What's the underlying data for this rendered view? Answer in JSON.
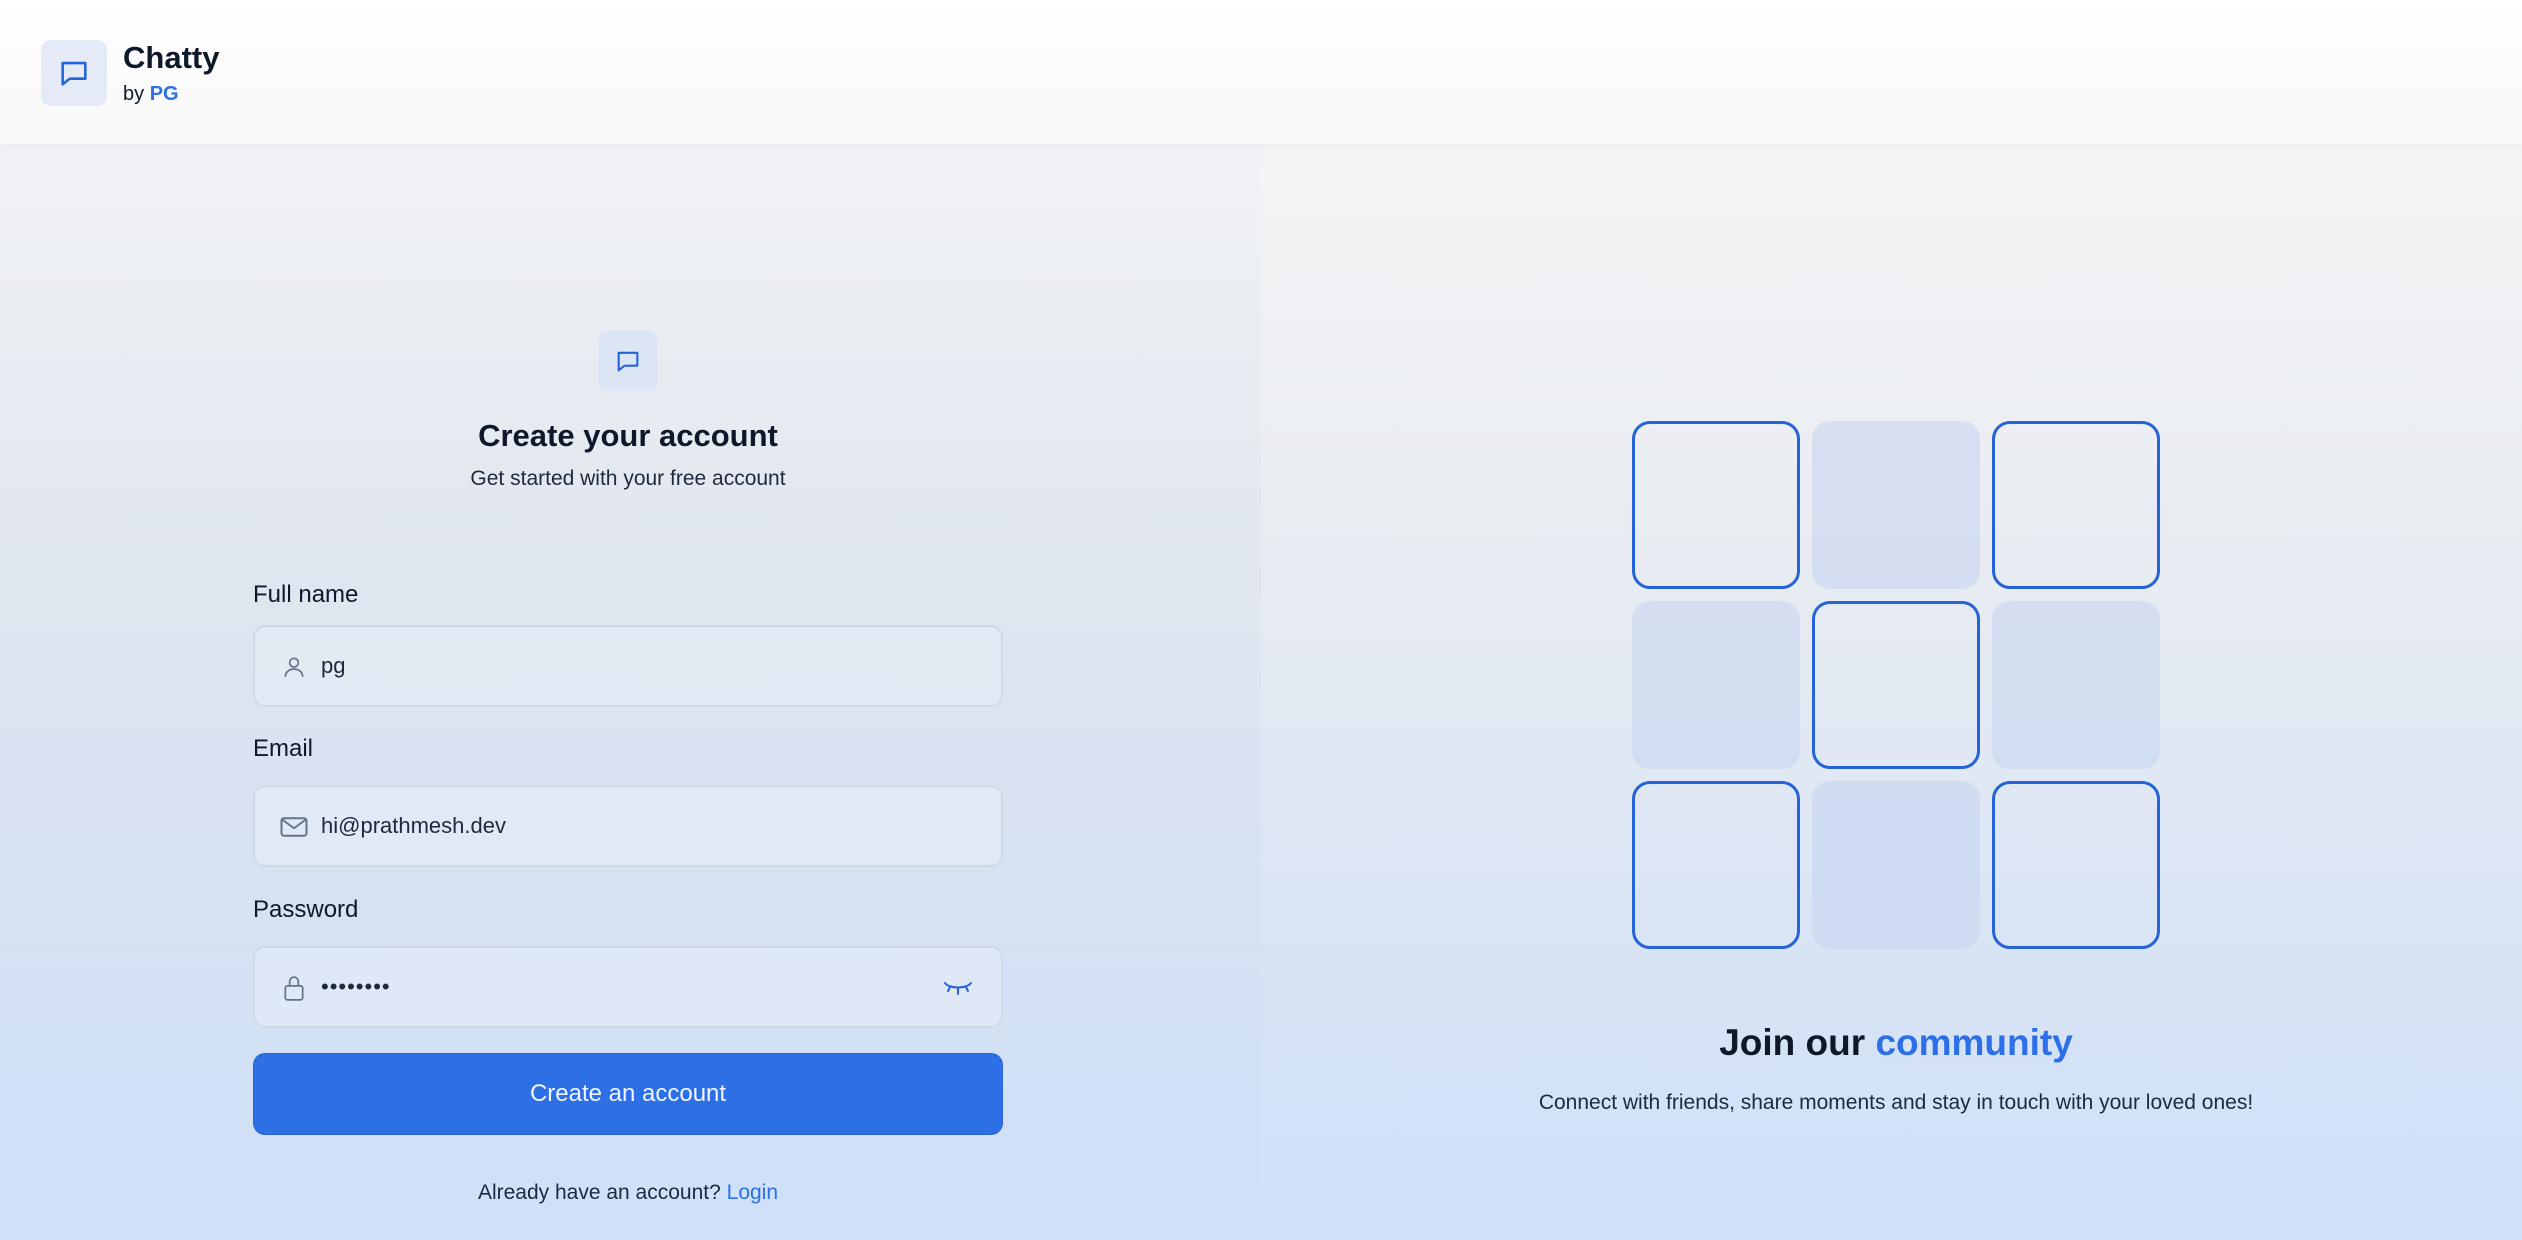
{
  "brand": {
    "name": "Chatty",
    "by_prefix": "by",
    "by_owner": "PG",
    "logo_icon": "chat-bubble-icon"
  },
  "form": {
    "logo_icon": "chat-bubble-icon",
    "title": "Create your account",
    "subtitle": "Get started with your free account",
    "fields": [
      {
        "label": "Full name",
        "value": "pg",
        "icon": "user-icon",
        "type": "text"
      },
      {
        "label": "Email",
        "value": "hi@prathmesh.dev",
        "icon": "mail-icon",
        "type": "email"
      },
      {
        "label": "Password",
        "value": "••••••••",
        "icon": "lock-icon",
        "type": "password",
        "toggle_icon": "eye-closed-icon"
      }
    ],
    "submit_label": "Create an account",
    "login_prompt": "Already have an account?",
    "login_link": "Login"
  },
  "community": {
    "title_prefix": "Join our",
    "title_accent": "community",
    "description": "Connect with friends, share moments and stay in touch with your loved ones!",
    "tiles": [
      "outlined",
      "filled",
      "outlined",
      "filled",
      "outlined",
      "filled",
      "outlined",
      "filled",
      "outlined"
    ]
  },
  "colors": {
    "accent": "#2c6fe6",
    "button": "#2d6fe4",
    "text": "#0f172a"
  }
}
